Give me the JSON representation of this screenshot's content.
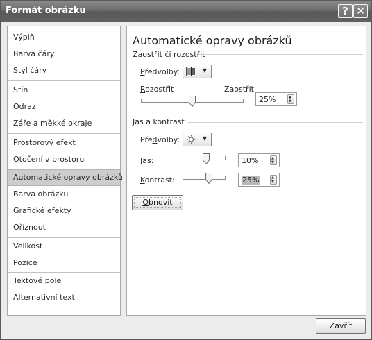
{
  "window": {
    "title": "Formát obrázku",
    "help_glyph": "?",
    "close_glyph": "✕"
  },
  "sidebar": {
    "items": [
      {
        "label": "Výplň"
      },
      {
        "label": "Barva čáry"
      },
      {
        "label": "Styl čáry"
      },
      {
        "label": "Stín"
      },
      {
        "label": "Odraz"
      },
      {
        "label": "Záře a měkké okraje"
      },
      {
        "label": "Prostorový efekt"
      },
      {
        "label": "Otočení v prostoru"
      },
      {
        "label": "Automatické opravy obrázků",
        "selected": true
      },
      {
        "label": "Barva obrázku"
      },
      {
        "label": "Grafické efekty"
      },
      {
        "label": "Oříznout"
      },
      {
        "label": "Velikost"
      },
      {
        "label": "Pozice"
      },
      {
        "label": "Textové pole"
      },
      {
        "label": "Alternativní text"
      }
    ]
  },
  "panel": {
    "title": "Automatické opravy obrázků",
    "sharpen": {
      "section_title": "Zaostřit či rozostřit",
      "presets_label_a": "P",
      "presets_label_b": "ředvolby:",
      "blur_label_a": "R",
      "blur_label_b": "ozostřit",
      "sharpen_label": "Zaostřit",
      "value": "25%",
      "slider_value": 0.5,
      "preset_icon": "sharpen-preset-icon"
    },
    "brightness": {
      "section_title": "Jas a kontrast",
      "presets_label_a": "Pře",
      "presets_label_b": "d",
      "presets_label_c": "volby:",
      "brightness_label_a": "J",
      "brightness_label_b": "as:",
      "brightness_value": "10%",
      "brightness_slider_value": 0.55,
      "contrast_label_a": "K",
      "contrast_label_b": "ontrast:",
      "contrast_value": "25%",
      "contrast_slider_value": 0.62,
      "preset_icon": "sun-preset-icon"
    },
    "reset_label_a": "O",
    "reset_label_b": "bnovit"
  },
  "footer": {
    "close_label": "Zavřít"
  },
  "colors": {
    "titlebar": "#6d6d6d",
    "selected_item": "#cdcdcd",
    "window_bg": "#ececec"
  }
}
